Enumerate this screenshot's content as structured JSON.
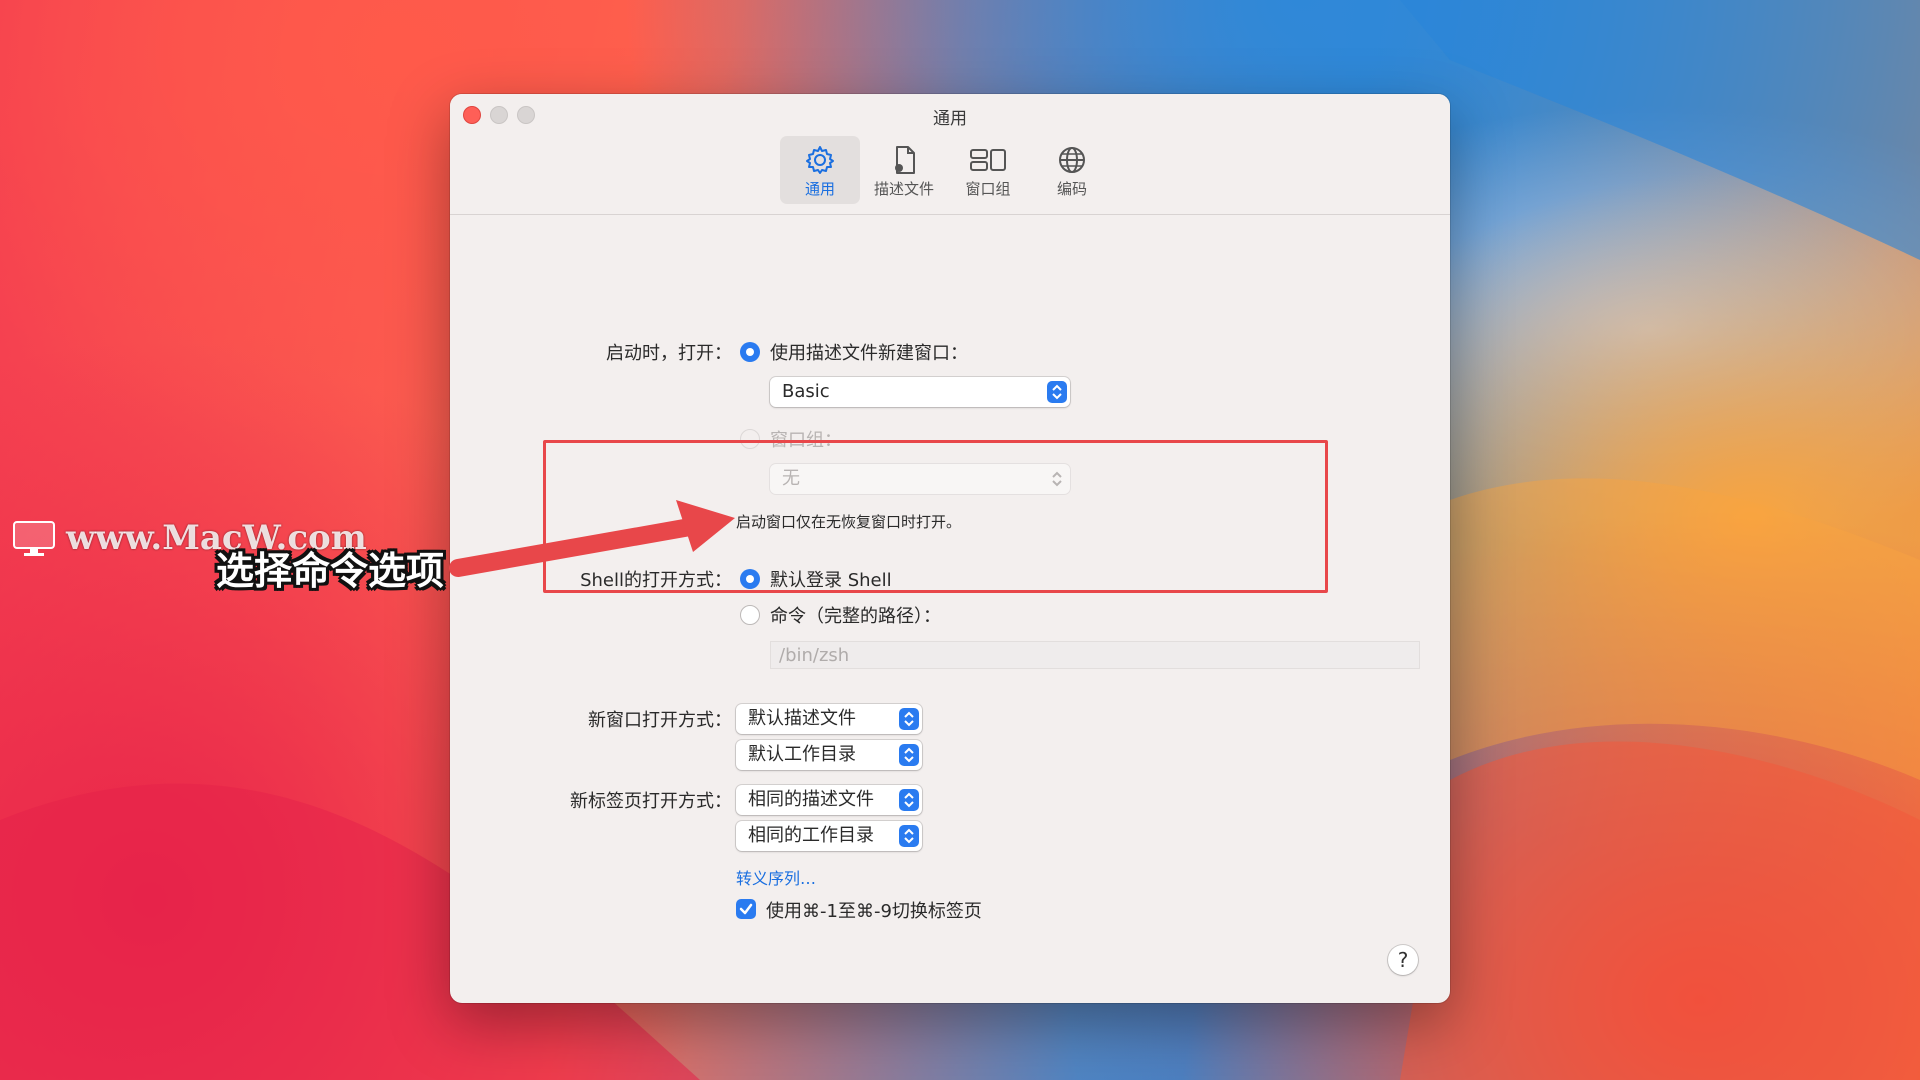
{
  "window": {
    "title": "通用"
  },
  "toolbar": {
    "items": [
      {
        "label": "通用",
        "icon": "gear-icon",
        "active": true
      },
      {
        "label": "描述文件",
        "icon": "profile-document-icon",
        "active": false
      },
      {
        "label": "窗口组",
        "icon": "window-group-icon",
        "active": false
      },
      {
        "label": "编码",
        "icon": "globe-icon",
        "active": false
      }
    ]
  },
  "startup": {
    "label": "启动时，打开：",
    "option_profile": "使用描述文件新建窗口：",
    "profile_value": "Basic",
    "option_group": "窗口组：",
    "group_value": "无",
    "note": "启动窗口仅在无恢复窗口时打开。"
  },
  "shell": {
    "label": "Shell的打开方式：",
    "option_default": "默认登录 Shell",
    "option_command": "命令（完整的路径）：",
    "command_placeholder": "/bin/zsh"
  },
  "new_window": {
    "label": "新窗口打开方式：",
    "profile": "默认描述文件",
    "directory": "默认工作目录"
  },
  "new_tab": {
    "label": "新标签页打开方式：",
    "profile": "相同的描述文件",
    "directory": "相同的工作目录"
  },
  "escape_link": "转义序列…",
  "tab_switch_checkbox": "使用⌘-1至⌘-9切换标签页",
  "help_button": "?",
  "annotation": {
    "text": "选择命令选项",
    "highlight_color": "#e8474a"
  },
  "watermark": "www.MacW.com",
  "colors": {
    "accent": "#2a7bf0",
    "close": "#fe5f57"
  }
}
